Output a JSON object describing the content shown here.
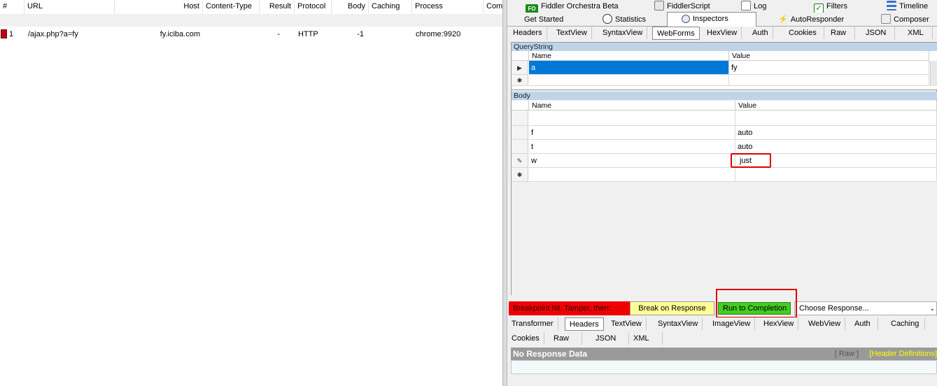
{
  "sessions": {
    "columns": [
      "#",
      "URL",
      "Host",
      "Content-Type",
      "Result",
      "Protocol",
      "Body",
      "Caching",
      "Process",
      "Comm"
    ],
    "rows": [
      {
        "num": "1",
        "url": "/ajax.php?a=fy",
        "host": "fy.iciba.com",
        "content_type": "",
        "result": "-",
        "protocol": "HTTP",
        "body": "-1",
        "caching": "",
        "process": "chrome:9920"
      }
    ]
  },
  "top_tabs_row1": [
    "Fiddler Orchestra Beta",
    "FiddlerScript",
    "Log",
    "Filters",
    "Timeline"
  ],
  "fo_badge": "FO",
  "top_tabs_row2": [
    "Get Started",
    "Statistics",
    "Inspectors",
    "AutoResponder",
    "Composer"
  ],
  "request_tabs": [
    "Headers",
    "TextView",
    "SyntaxView",
    "WebForms",
    "HexView",
    "Auth",
    "Cookies",
    "Raw",
    "JSON",
    "XML"
  ],
  "querystring": {
    "title": "QueryString",
    "col_name": "Name",
    "col_value": "Value",
    "rows": [
      {
        "name": "a",
        "value": "fy"
      }
    ]
  },
  "body": {
    "title": "Body",
    "col_name": "Name",
    "col_value": "Value",
    "rows": [
      {
        "name": "f",
        "value": "auto"
      },
      {
        "name": "t",
        "value": "auto"
      },
      {
        "name": "w",
        "value": "just"
      }
    ]
  },
  "breakpoint": {
    "message": "Breakpoint hit. Tamper, then:",
    "break_on_response": "Break on Response",
    "run_to_completion": "Run to Completion",
    "choose_response": "Choose Response...",
    "colors": {
      "bar": "#ee0000",
      "break_btn": "#ffff99",
      "run_btn": "#44cc22",
      "highlight": "#e00000"
    }
  },
  "response_tabs_row1": [
    "Transformer",
    "Headers",
    "TextView",
    "SyntaxView",
    "ImageView",
    "HexView",
    "WebView",
    "Auth",
    "Caching"
  ],
  "response_tabs_row2": [
    "Cookies",
    "Raw",
    "JSON",
    "XML"
  ],
  "response": {
    "no_data": "No Response Data",
    "raw_link": "[ Raw ]",
    "header_defs_link": "[Header Definitions]"
  }
}
